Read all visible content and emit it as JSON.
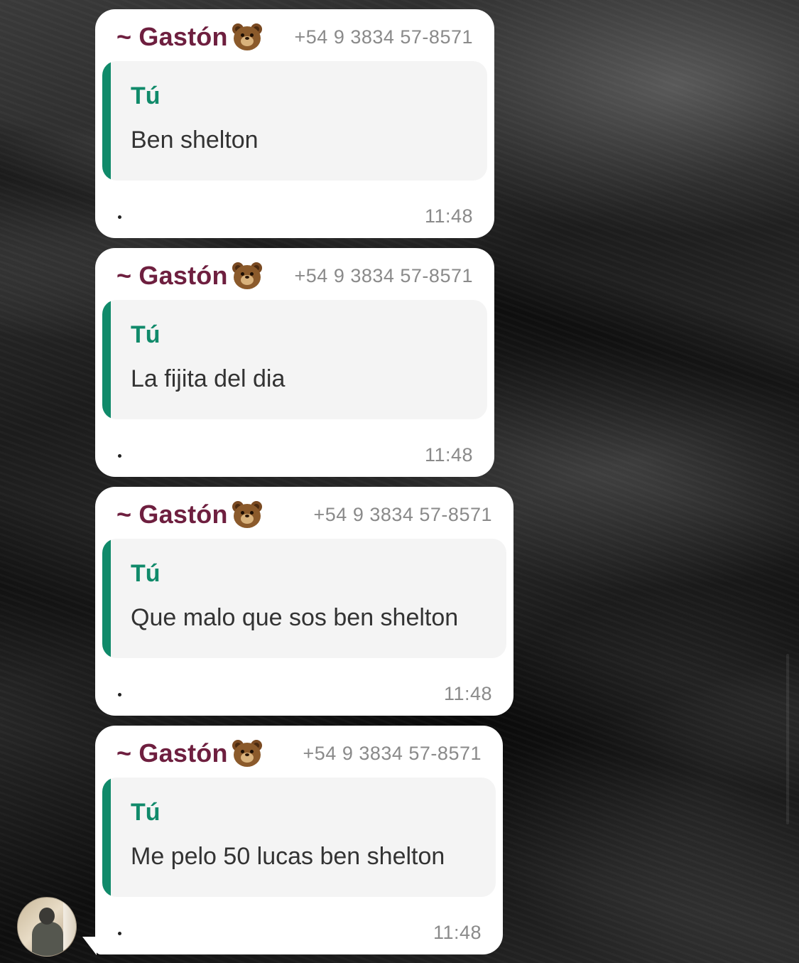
{
  "messages": [
    {
      "sender": "~ Gastón",
      "sender_icon": "bear-emoji",
      "phone": "+54 9 3834 57-8571",
      "quote_author": "Tú",
      "quote_text": "Ben shelton",
      "time": "11:48"
    },
    {
      "sender": "~ Gastón",
      "sender_icon": "bear-emoji",
      "phone": "+54 9 3834 57-8571",
      "quote_author": "Tú",
      "quote_text": "La fijita del dia",
      "time": "11:48"
    },
    {
      "sender": "~ Gastón",
      "sender_icon": "bear-emoji",
      "phone": "+54 9 3834 57-8571",
      "quote_author": "Tú",
      "quote_text": "Que malo que sos ben shelton",
      "time": "11:48"
    },
    {
      "sender": "~ Gastón",
      "sender_icon": "bear-emoji",
      "phone": "+54 9 3834 57-8571",
      "quote_author": "Tú",
      "quote_text": "Me pelo 50 lucas ben shelton",
      "time": "11:48"
    }
  ],
  "colors": {
    "sender_name": "#6e1f3f",
    "quote_accent": "#108a6a",
    "bubble_bg": "#ffffff",
    "meta_text": "#8a8a8a"
  }
}
